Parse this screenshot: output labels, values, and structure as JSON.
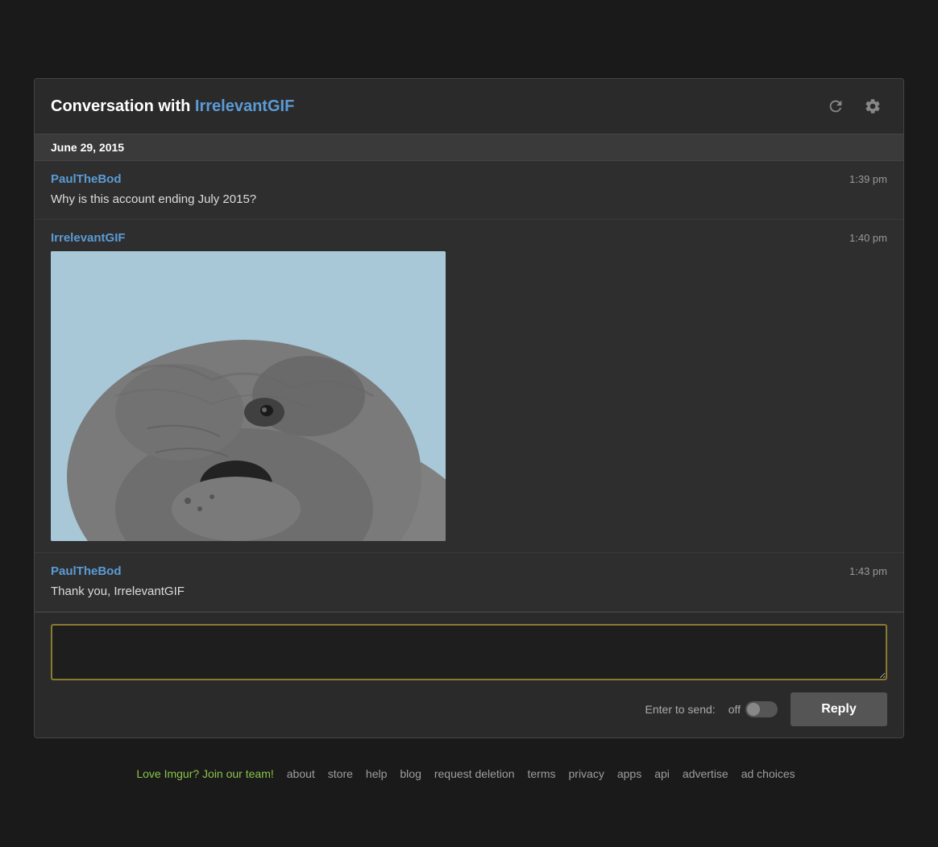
{
  "header": {
    "title_prefix": "Conversation with ",
    "title_user": "IrrelevantGIF",
    "refresh_label": "refresh",
    "settings_label": "settings"
  },
  "date_bar": {
    "date": "June 29, 2015"
  },
  "messages": [
    {
      "username": "PaulTheBod",
      "time": "1:39 pm",
      "text": "Why is this account ending July 2015?",
      "has_image": false
    },
    {
      "username": "IrrelevantGIF",
      "time": "1:40 pm",
      "text": "",
      "has_image": true
    },
    {
      "username": "PaulTheBod",
      "time": "1:43 pm",
      "text": "Thank you, IrrelevantGIF",
      "has_image": false
    }
  ],
  "reply_area": {
    "placeholder": "",
    "enter_to_send_label": "Enter to send:",
    "toggle_state": "off",
    "reply_button_label": "Reply"
  },
  "footer": {
    "love_text": "Love Imgur? Join our team!",
    "links": [
      "about",
      "store",
      "help",
      "blog",
      "request deletion",
      "terms",
      "privacy",
      "apps",
      "api",
      "advertise",
      "ad choices"
    ]
  }
}
